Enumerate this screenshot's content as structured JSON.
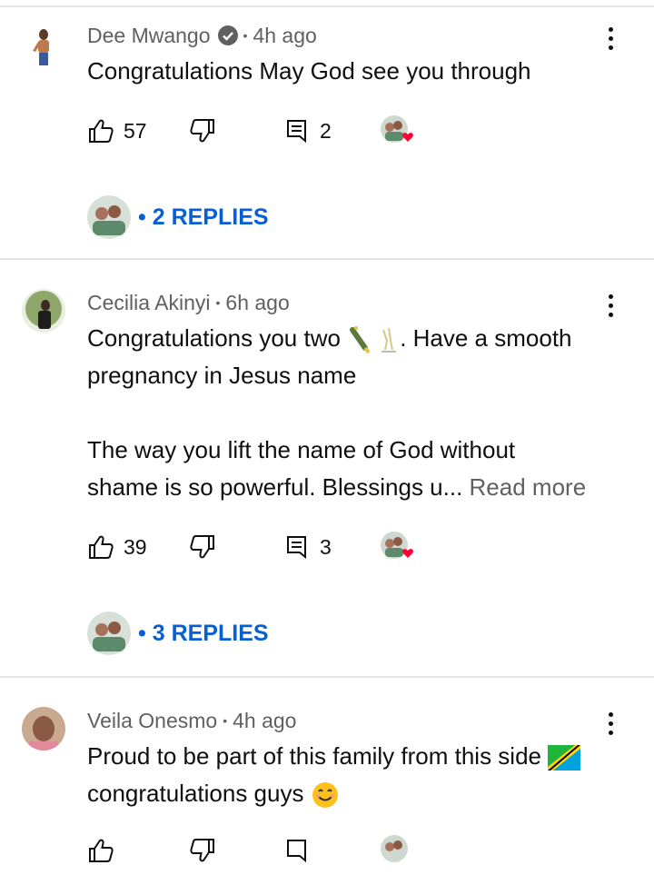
{
  "comments": [
    {
      "author": "Dee Mwango",
      "verified": true,
      "time": "4h ago",
      "lines": [
        "Congratulations May God see you through"
      ],
      "likes": "57",
      "replies_count": "2",
      "replies_label": "2 REPLIES"
    },
    {
      "author": "Cecilia Akinyi",
      "verified": false,
      "time": "6h ago",
      "line1_a": "Congratulations you two",
      "line1_b": ". Have a smooth",
      "line2": "pregnancy in Jesus name",
      "line3": "The way you lift the name of God without",
      "line4": "shame is so powerful. Blessings u...",
      "read_more": "Read more",
      "likes": "39",
      "replies_count": "3",
      "replies_label": "3 REPLIES"
    },
    {
      "author": "Veila Onesmo",
      "verified": false,
      "time": "4h ago",
      "line1": "Proud to be part of this family from this side",
      "line2": "congratulations guys"
    }
  ],
  "separator": "•",
  "colors": {
    "link": "#065fd4",
    "meta": "#606060",
    "divider": "#e5e5e5",
    "heart": "#ff0033"
  },
  "icons": [
    "thumbs-up-icon",
    "thumbs-down-icon",
    "reply-icon",
    "more-vert-icon",
    "verified-icon",
    "heart-icon",
    "champagne-emoji",
    "tanzania-flag-emoji",
    "smile-emoji"
  ]
}
